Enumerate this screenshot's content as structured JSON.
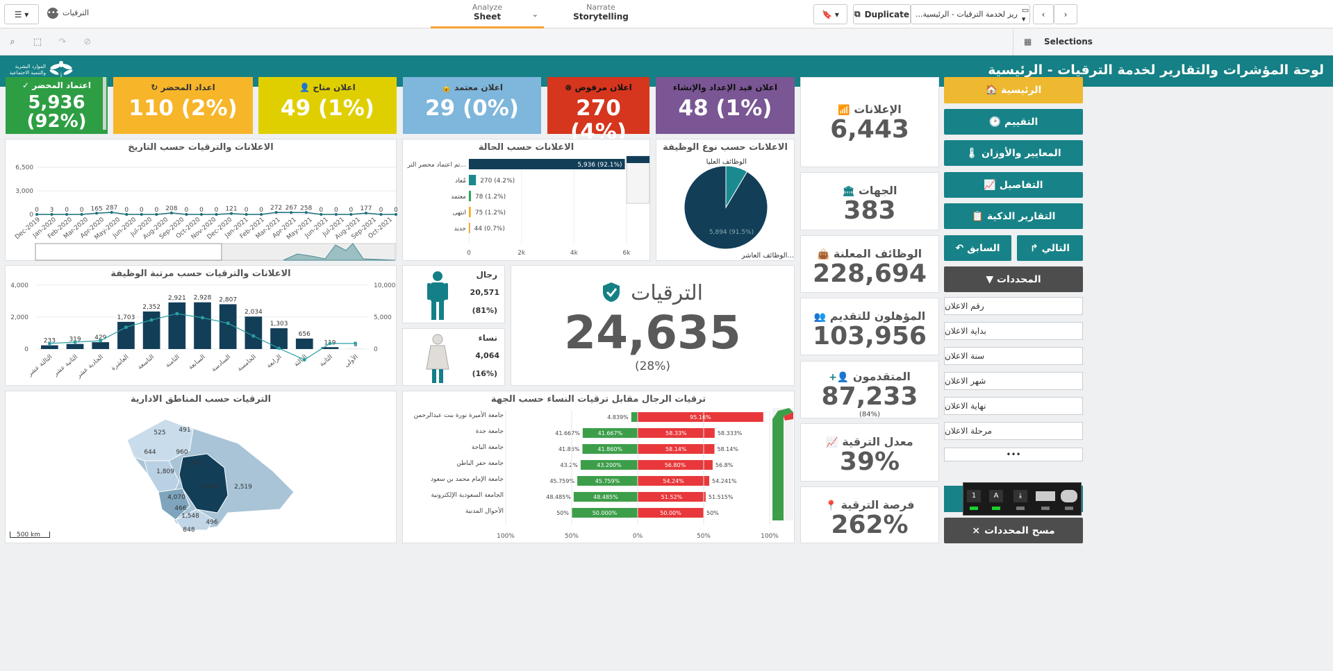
{
  "app": {
    "name": "الترقيات",
    "analyze_label": "Analyze",
    "analyze_value": "Sheet",
    "narrate_label": "Narrate",
    "narrate_value": "Storytelling",
    "duplicate": "Duplicate",
    "sheet_name": "...ريز لخدمة الترقيات - الرئيسية",
    "selections": "Selections"
  },
  "banner": {
    "title": "لوحة المؤشرات والتقارير لخدمة الترقيات - الرئيسية",
    "logo_line1": "الموارد البشرية",
    "logo_line2": "والتنمية الاجتماعية"
  },
  "kpis": [
    {
      "title": "اعتماد المحضر ✓",
      "value1": "5,936",
      "value2": "(92%)",
      "color": "#2e9e44"
    },
    {
      "title": "اعداد المحضر ↻",
      "value": "110 (2%)",
      "color": "#f7b529"
    },
    {
      "title": "اعلان متاح 👤",
      "value": "49 (1%)",
      "color": "#e0cf00"
    },
    {
      "title": "اعلان معتمد 🔒",
      "value": "29 (0%)",
      "color": "#7eb6dc"
    },
    {
      "title": "اعلان مرفوض ⊗",
      "value": "270 (4%)",
      "color": "#d5361d"
    },
    {
      "title": "اعلان قيد الإعداد والإنشاء",
      "value": "48 (1%)",
      "color": "#7a5694"
    }
  ],
  "metrics": [
    {
      "title": "الإعلانات",
      "value": "6,443",
      "icon": "wifi-icon"
    },
    {
      "title": "الجهات",
      "value": "383",
      "icon": "bank-icon"
    },
    {
      "title": "الوظائف المعلنة",
      "value": "228,694",
      "icon": "bag-icon"
    },
    {
      "title": "المؤهلون للتقديم",
      "value": "103,956",
      "icon": "users-icon"
    },
    {
      "title": "المتقدمون",
      "value": "87,233",
      "sub": "(84%)",
      "icon": "user-plus-icon"
    },
    {
      "title": "معدل الترقية",
      "value": "39%",
      "icon": "chart-icon"
    },
    {
      "title": "فرصة الترقية",
      "value": "262%",
      "icon": "pin-icon"
    }
  ],
  "nav": {
    "home": "الرئيسية 🏠",
    "eval": "التقييم 🕑",
    "criteria": "المعايير والأوزان 🌡",
    "details": "التفاصيل 📈",
    "smart": "التقارير الذكية 📋",
    "next": "التالي ↱",
    "prev": "السابق ↶",
    "filters": "المحددات ▼",
    "clear": "مسح المحددات"
  },
  "filters": [
    "رقم الاعلان",
    "بداية الاعلان",
    "سنة الاعلان",
    "شهر الاعلان",
    "نهاية الاعلان",
    "مرحلة الاعلان"
  ],
  "more": "•••",
  "promo": {
    "title": "الترقيات",
    "value": "24,635",
    "pct": "(28%)"
  },
  "men": {
    "label": "رجال",
    "value": "20,571",
    "pct": "(81%)"
  },
  "women": {
    "label": "نساء",
    "value": "4,064",
    "pct": "(16%)"
  },
  "titles": {
    "date": "الاعلانات والترقيات حسب التاريخ",
    "status": "الاعلانات حسب الحالة",
    "jobtype": "الاعلانات حسب نوع الوظيفة",
    "rank": "الاعلانات والترقيات حسب مرتبة الوظيفة",
    "map": "الترقيات حسب المناطق الادارية",
    "compare": "ترقيات الرجال مقابل ترقيات النساء حسب الجهة",
    "scale": "500 km"
  },
  "chart_data": [
    {
      "type": "line",
      "title": "الاعلانات والترقيات حسب التاريخ",
      "categories": [
        "Dec-2019",
        "Jan-2020",
        "Feb-2020",
        "Mar-2020",
        "Apr-2020",
        "May-2020",
        "Jun-2020",
        "Jul-2020",
        "Aug-2020",
        "Sep-2020",
        "Oct-2020",
        "Nov-2020",
        "Dec-2020",
        "Jan-2021",
        "Feb-2021",
        "Mar-2021",
        "Apr-2021",
        "May-2021",
        "Jun-2021",
        "Jul-2021",
        "Aug-2021",
        "Sep-2021",
        "Oct-2021"
      ],
      "labels": [
        "0",
        "3",
        "0",
        "0",
        "165",
        "287",
        "0",
        "0",
        "0",
        "208",
        "0",
        "0",
        "0",
        "121",
        "0",
        "0",
        "272",
        "267",
        "258",
        "0",
        "0",
        "0",
        "177",
        "0",
        "0"
      ],
      "yticks": [
        "6,500",
        "3,000",
        "0"
      ],
      "ylim": [
        0,
        6500
      ]
    },
    {
      "type": "bar",
      "title": "الاعلانات حسب الحالة",
      "categories": [
        "تم اعتماد محضر التر...",
        "مُعاد",
        "معتمد",
        "انتهى",
        "جديد"
      ],
      "values": [
        5936,
        270,
        78,
        75,
        44
      ],
      "labels": [
        "5,936 (92.1%)",
        "270 (4.2%)",
        "78 (1.2%)",
        "75 (1.2%)",
        "44 (0.7%)"
      ],
      "colors": [
        "#123e58",
        "#1a8a8f",
        "#2aa35a",
        "#f0b129",
        "#e8a020"
      ],
      "xticks": [
        "0",
        "2k",
        "4k",
        "6k"
      ],
      "xlim": [
        0,
        6000
      ]
    },
    {
      "type": "pie",
      "title": "الاعلانات حسب نوع الوظيفة",
      "categories": [
        "الوظائف العليا",
        "الوظائف العاشر..."
      ],
      "values": [
        549,
        5894
      ],
      "slice_label": "5,894 (91.5%)"
    },
    {
      "type": "bar",
      "title": "الاعلانات والترقيات حسب مرتبة الوظيفة",
      "categories": [
        "الثالثة عشر",
        "الثانية عشر",
        "الحادية عشر",
        "العاشرة",
        "التاسعة",
        "الثامنة",
        "السابعة",
        "السادسة",
        "الخامسة",
        "الرابعة",
        "الثالثة",
        "الثانية",
        "الأولى"
      ],
      "values": [
        233,
        319,
        429,
        1703,
        2352,
        2921,
        2928,
        2807,
        2034,
        1303,
        656,
        119,
        3
      ],
      "labels": [
        "233",
        "319",
        "429",
        "1,703",
        "2,352",
        "2,921",
        "2,928",
        "2,807",
        "2,034",
        "1,303",
        "656",
        "119",
        "3"
      ],
      "yticks_left": [
        "4,000",
        "2,000",
        "0"
      ],
      "yticks_right": [
        "10,000",
        "5,000",
        "0"
      ],
      "ylim": [
        0,
        4000
      ]
    },
    {
      "type": "bar",
      "title": "ترقيات الرجال مقابل ترقيات النساء حسب الجهة",
      "categories": [
        "جامعة الأميرة نورة بنت عبدالرحمن",
        "جامعة جدة",
        "جامعة الباحة",
        "جامعة حفر الباطن",
        "جامعة الإمام محمد بن سعود",
        "الجامعة السعودية الإلكترونية",
        "الأحوال المدنية"
      ],
      "women": [
        4.839,
        41.667,
        41.86,
        43.2,
        45.759,
        48.485,
        50
      ],
      "men": [
        95.16,
        58.33,
        58.14,
        56.8,
        54.24,
        51.52,
        50
      ],
      "women_labels": [
        "4.839%",
        "41.667%",
        "41.86%",
        "43.2%",
        "45.759%",
        "48.485%",
        "50%"
      ],
      "women_inner": [
        "",
        "41.667%",
        "41.860%",
        "43.200%",
        "45.759%",
        "48.485%",
        "50.000%"
      ],
      "men_labels": [
        "95.16%",
        "58.33%",
        "58.14%",
        "56.80%",
        "54.24%",
        "51.52%",
        "50.00%"
      ],
      "men_outer": [
        "",
        "58.333%",
        "58.14%",
        "56.8%",
        "54.241%",
        "51.515%",
        "50%"
      ],
      "xticks": [
        "100%",
        "50%",
        "0%",
        "50%",
        "100%"
      ]
    }
  ],
  "map_values": [
    "525",
    "491",
    "644",
    "960",
    "1,809",
    "1,597",
    "8,648",
    "2,519",
    "4,070",
    "466",
    "1,548",
    "496",
    "848"
  ]
}
